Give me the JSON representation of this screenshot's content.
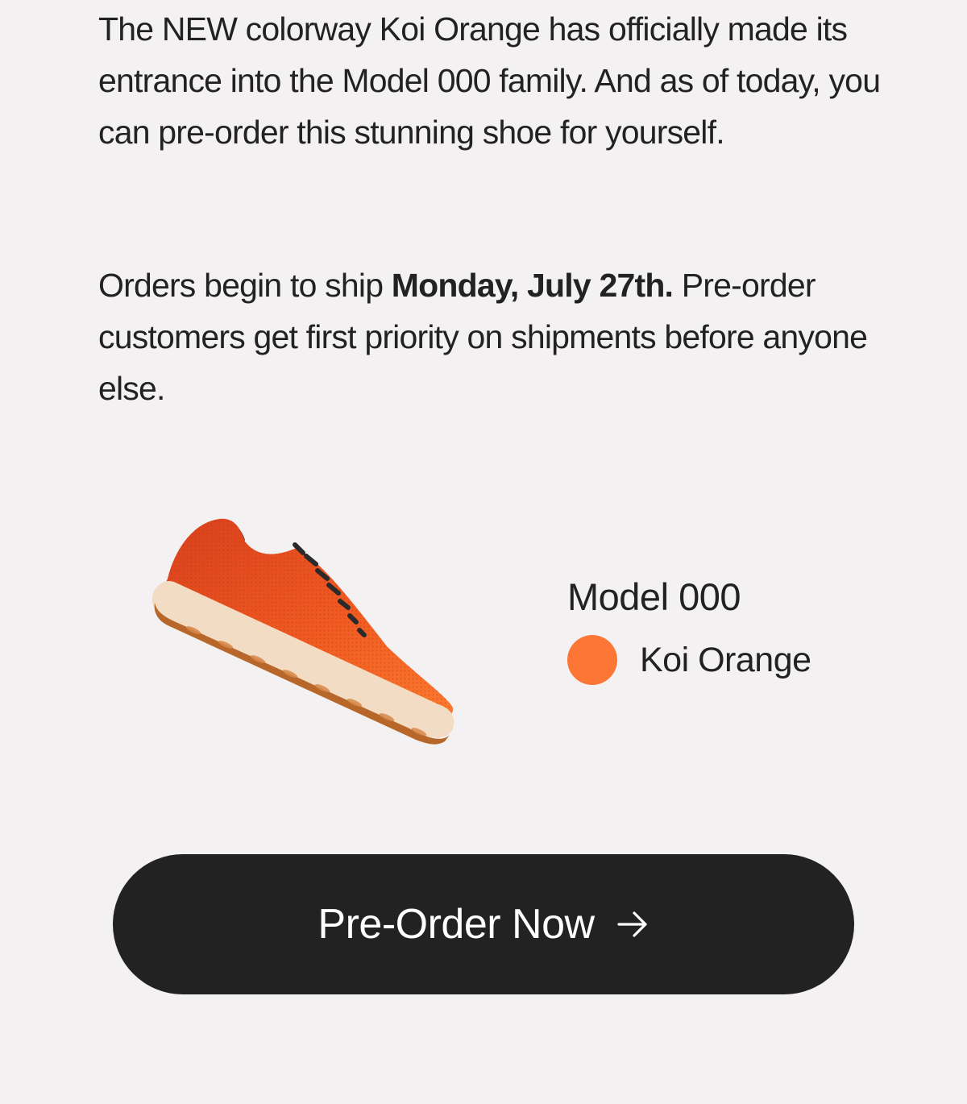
{
  "intro": {
    "text": "The NEW colorway Koi Orange has officially made its entrance into the Model 000 family. And as of today, you can pre-order this stunning shoe for yourself."
  },
  "shipping": {
    "prefix": "Orders begin to ship ",
    "date": "Monday, July 27th.",
    "suffix": " Pre-order customers get first priority on shipments before anyone else."
  },
  "product": {
    "name": "Model 000",
    "color_name": "Koi Orange",
    "swatch_color": "#fe7636",
    "image_icon": "shoe-image"
  },
  "cta": {
    "label": "Pre-Order Now",
    "icon": "arrow-right-icon"
  },
  "colors": {
    "background": "#f3f1f1",
    "text": "#222222",
    "button": "#222222",
    "button_text": "#ffffff",
    "accent": "#fe7636"
  }
}
